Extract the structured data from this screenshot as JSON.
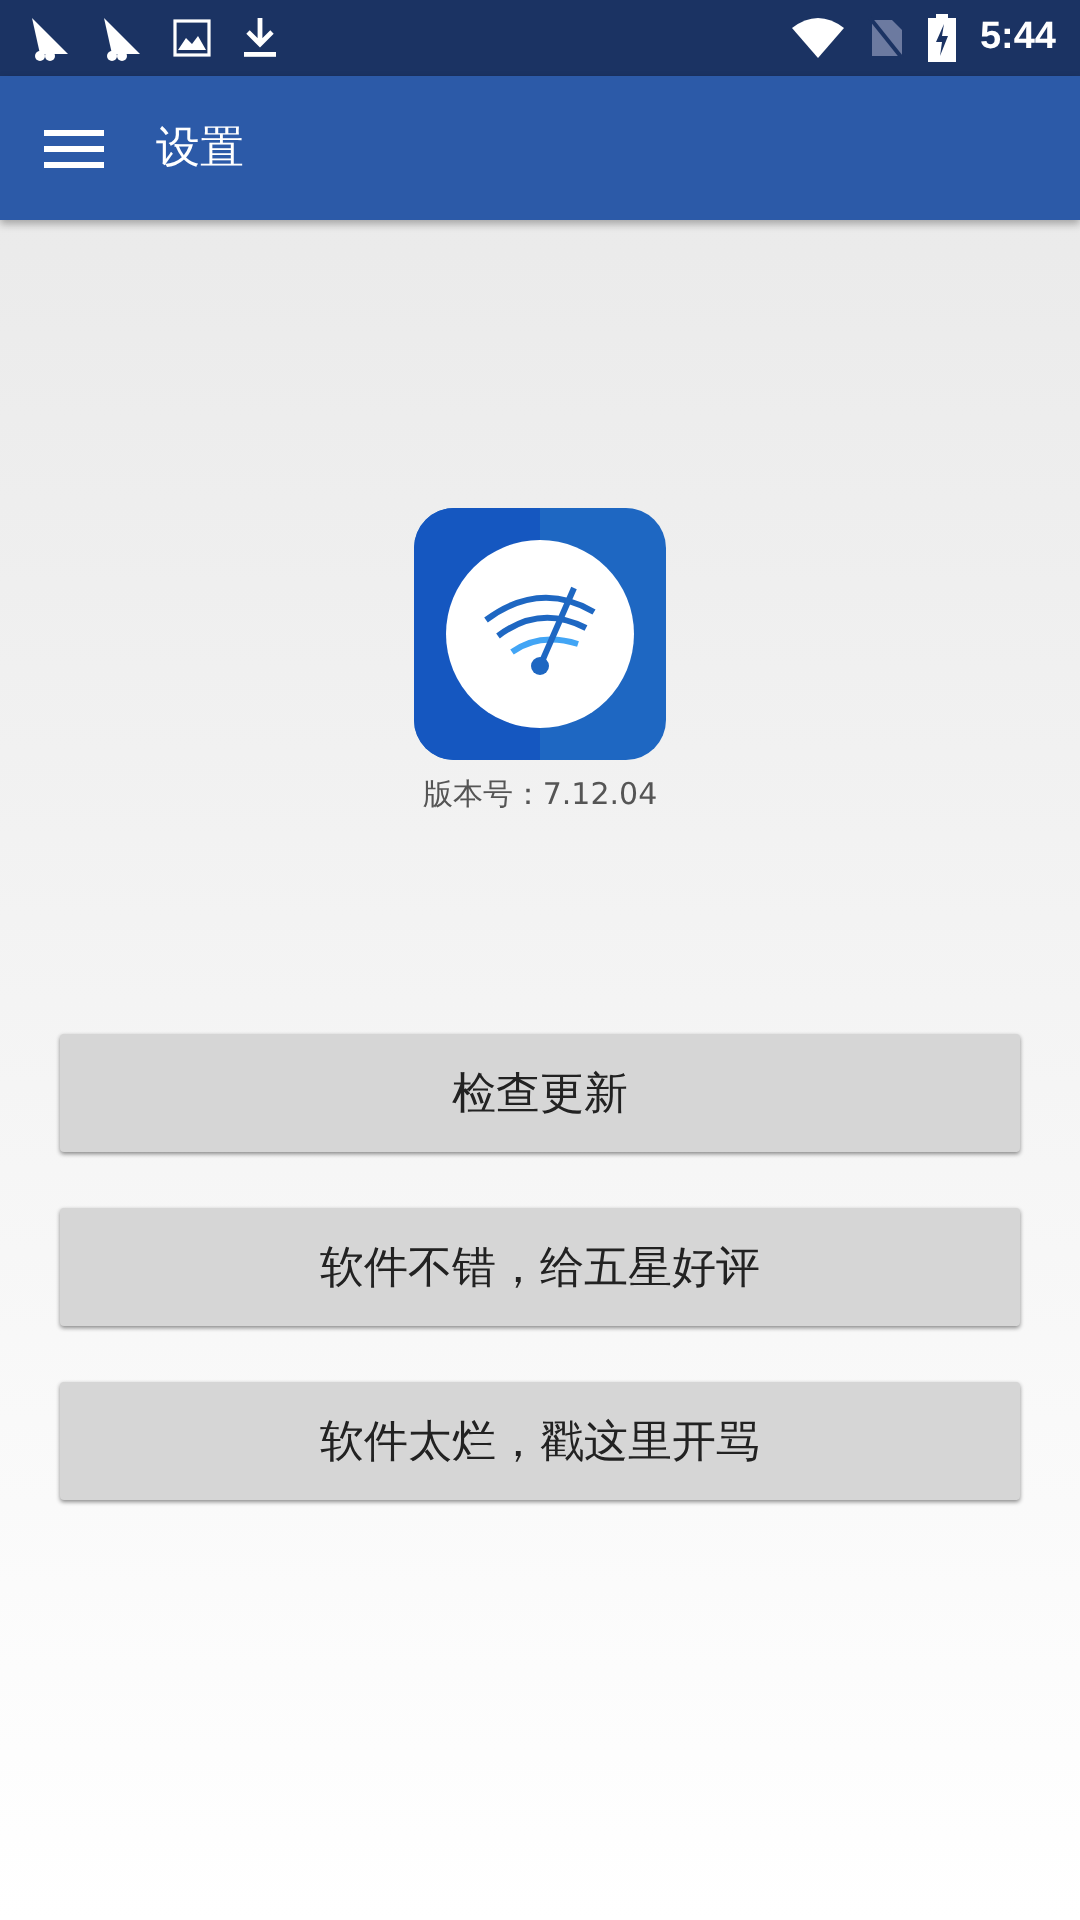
{
  "status_bar": {
    "time": "5:44"
  },
  "app_bar": {
    "title": "设置"
  },
  "version": "版本号：7.12.04",
  "buttons": [
    "检查更新",
    "软件不错，给五星好评",
    "软件太烂，戳这里开骂"
  ]
}
